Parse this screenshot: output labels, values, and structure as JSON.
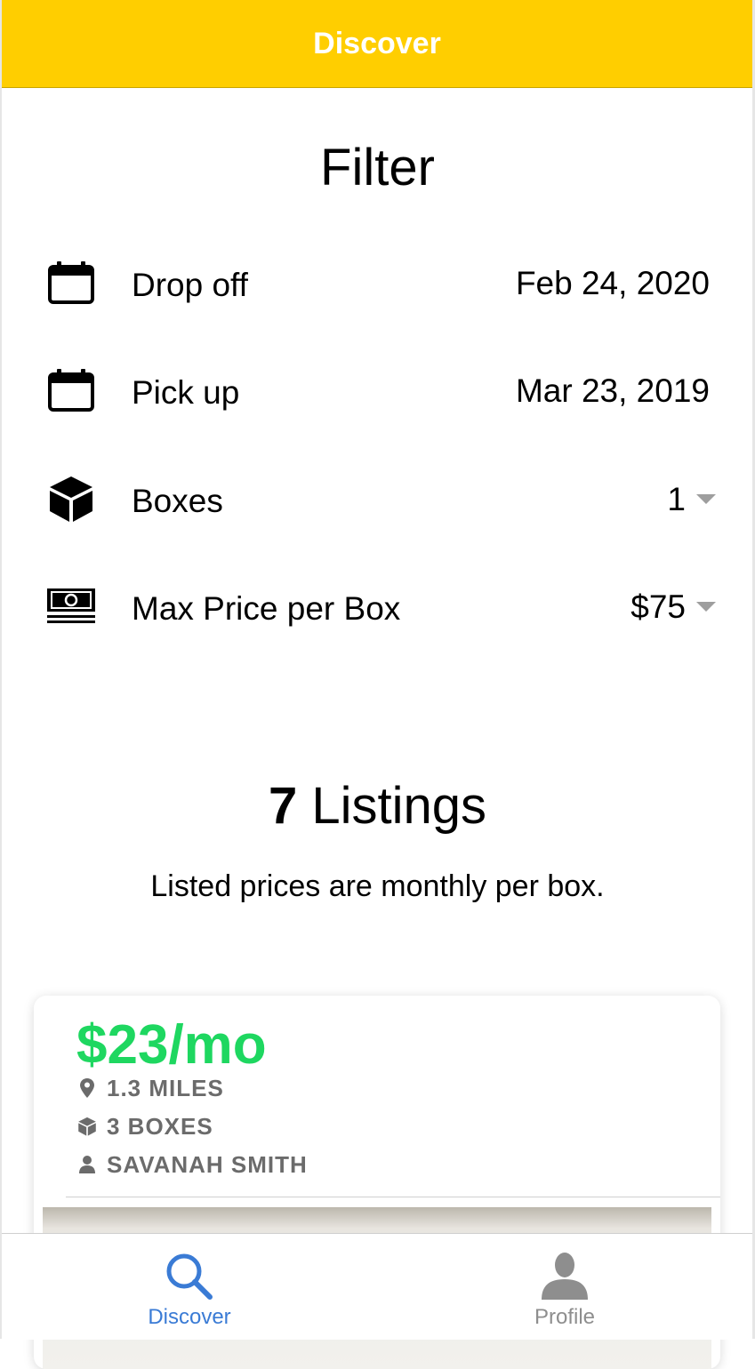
{
  "header": {
    "title": "Discover"
  },
  "filter": {
    "title": "Filter",
    "rows": [
      {
        "icon": "calendar-icon",
        "label": "Drop off",
        "value": "Feb 24, 2020"
      },
      {
        "icon": "calendar-icon",
        "label": "Pick up",
        "value": "Mar 23, 2019"
      },
      {
        "icon": "box-icon",
        "label": "Boxes",
        "value": "1"
      },
      {
        "icon": "money-icon",
        "label": "Max Price per Box",
        "value": "$75"
      }
    ]
  },
  "listings": {
    "count": "7",
    "title_suffix": "Listings",
    "subtitle": "Listed prices are monthly per box."
  },
  "card": {
    "price": "$23/mo",
    "distance": "1.3 MILES",
    "boxes": "3 BOXES",
    "owner": "SAVANAH SMITH"
  },
  "tabs": [
    {
      "label": "Discover",
      "icon": "search-icon",
      "active": true
    },
    {
      "label": "Profile",
      "icon": "person-icon",
      "active": false
    }
  ],
  "colors": {
    "header": "#ffce00",
    "price": "#1ed760",
    "tab_active": "#3a7bd5",
    "tab_inactive": "#8e8e8e",
    "caret": "#9e9e9e",
    "meta": "#6b6b6b"
  }
}
